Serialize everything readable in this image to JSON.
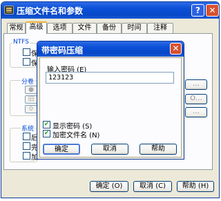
{
  "window": {
    "title": "压缩文件名和参数",
    "help_glyph": "?",
    "close_glyph": "✕"
  },
  "tabs": [
    "常规",
    "高级",
    "选项",
    "文件",
    "备份",
    "时间",
    "注释"
  ],
  "background": {
    "ntfs_label": "NTFS",
    "ntfs_items": [
      "保",
      "保"
    ],
    "split_label": "分卷",
    "split_items": [
      "●",
      "旧",
      "0"
    ],
    "system_label": "系统",
    "system_items": [
      "后",
      "完",
      "加"
    ],
    "side_btn_1": "…",
    "side_btn_2": "O…",
    "side_btn_3": "…"
  },
  "buttons": {
    "ok": "确定 (O)",
    "cancel": "取消 (C)",
    "help": "帮助 (H)"
  },
  "dialog": {
    "title": "带密码压缩",
    "close_glyph": "✕",
    "password_label": "输入密码 (E)",
    "password_value": "123123",
    "show_password_label": "显示密码 (S)",
    "show_password_checked": true,
    "encrypt_names_label": "加密文件名 (N)",
    "encrypt_names_checked": true,
    "checkmark": "✔",
    "ok": "确定",
    "cancel": "取消",
    "help": "帮助"
  },
  "colors": {
    "titlebar": "#0a4fd6",
    "close_button": "#d7512f",
    "window_face": "#ece9d8",
    "active_tab_highlight": "#f0b030",
    "group_label": "#0046d5"
  },
  "icons": {
    "app_icon": "archive-books-icon",
    "help": "question-mark-icon",
    "close": "close-x-icon",
    "checked": "checkmark-icon"
  }
}
